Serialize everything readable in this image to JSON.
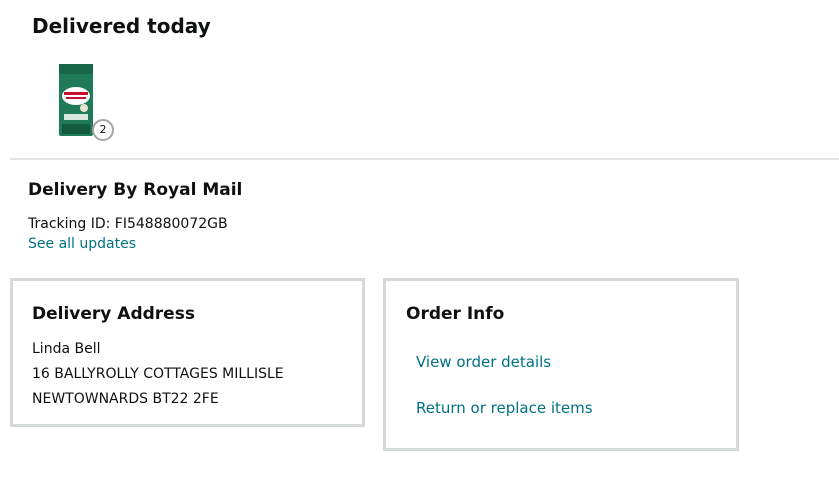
{
  "status": {
    "title": "Delivered today"
  },
  "product": {
    "quantity": "2",
    "image_icon": "royal-canin-dog-food-bag"
  },
  "carrier": {
    "title": "Delivery By Royal Mail",
    "tracking": "Tracking ID: FI548880072GB",
    "see_updates": "See all updates"
  },
  "address": {
    "title": "Delivery Address",
    "name": "Linda Bell",
    "line1": "16 BALLYROLLY COTTAGES MILLISLE",
    "line2": "NEWTOWNARDS BT22 2FE"
  },
  "order_info": {
    "title": "Order Info",
    "view_details": "View order details",
    "return_replace": "Return or replace items"
  },
  "colors": {
    "link": "#007185",
    "border": "#d5d9d9",
    "text": "#0f1111"
  }
}
